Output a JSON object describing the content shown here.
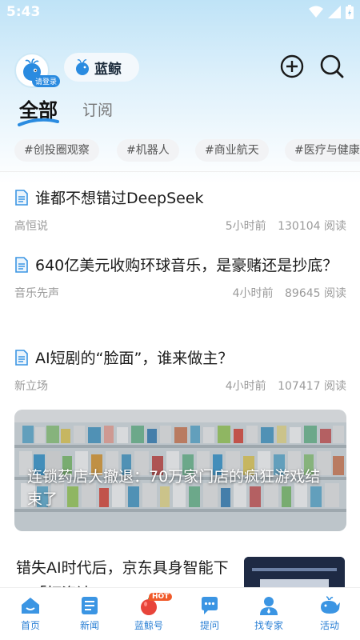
{
  "status": {
    "time": "5:43"
  },
  "header": {
    "login_label": "请登录",
    "brand_name": "蓝鲸"
  },
  "tabs": [
    {
      "label": "全部",
      "active": true
    },
    {
      "label": "订阅",
      "active": false
    }
  ],
  "chips": [
    "#创投圈观察",
    "#机器人",
    "#商业航天",
    "#医疗与健康"
  ],
  "articles": [
    {
      "title": "谁都不想错过DeepSeek",
      "source": "高恒说",
      "time": "5小时前",
      "reads": "130104 阅读"
    },
    {
      "title": "640亿美元收购环球音乐，是豪赌还是抄底？",
      "source": "音乐先声",
      "time": "4小时前",
      "reads": "89645 阅读"
    },
    {
      "title": "AI短剧的“脸面”，谁来做主？",
      "source": "新立场",
      "time": "4小时前",
      "reads": "107417 阅读"
    }
  ],
  "banner": {
    "title": "连锁药店大撤退：70万家门店的疯狂游戏结束了"
  },
  "article5": {
    "title": "错失AI时代后，京东具身智能下一「打资达...?"
  },
  "bottom_nav": [
    {
      "label": "首页",
      "icon": "home-icon"
    },
    {
      "label": "新闻",
      "icon": "news-icon"
    },
    {
      "label": "蓝鲸号",
      "icon": "apple-icon",
      "badge": "HOT"
    },
    {
      "label": "提问",
      "icon": "chat-icon"
    },
    {
      "label": "找专家",
      "icon": "expert-icon"
    },
    {
      "label": "活动",
      "icon": "whale-icon"
    }
  ],
  "colors": {
    "accent": "#2a8be0",
    "nav_label": "#2a7fd4",
    "hot": "#f05a2a"
  }
}
